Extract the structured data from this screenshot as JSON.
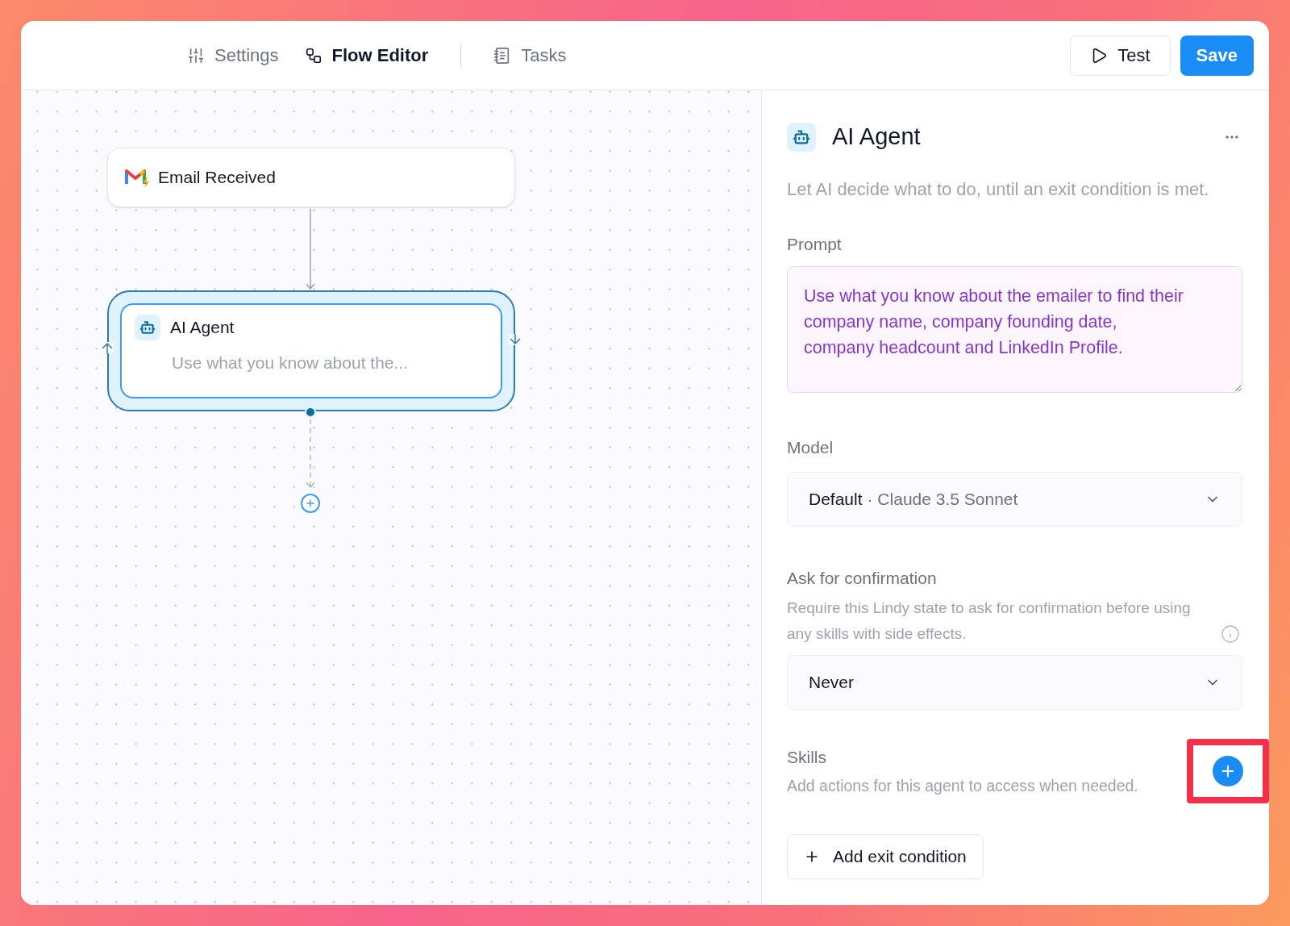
{
  "tabs": [
    {
      "label": "Settings",
      "kind": "settings",
      "selected": false
    },
    {
      "label": "Flow Editor",
      "kind": "flow",
      "selected": true
    },
    {
      "label": "Tasks",
      "kind": "tasks",
      "selected": false
    }
  ],
  "actions": {
    "test": "Test",
    "save": "Save"
  },
  "canvas": {
    "nodes": [
      {
        "kind": "trigger",
        "title": "Email Received"
      },
      {
        "kind": "agent",
        "title": "AI Agent",
        "subtitle": "Use what you know about the...",
        "selected": true
      }
    ]
  },
  "panel": {
    "title": "AI Agent",
    "description": "Let AI decide what to do, until an exit condition is met.",
    "prompt": {
      "label": "Prompt",
      "value": "Use what you know about the emailer to find their company name, company founding date, company headcount and LinkedIn Profile."
    },
    "model": {
      "label": "Model",
      "value": "Default",
      "detail": "· Claude 3.5 Sonnet"
    },
    "confirmation": {
      "label": "Ask for confirmation",
      "description": "Require this Lindy state to ask for confirmation before using any skills with side effects.",
      "value": "Never"
    },
    "skills": {
      "label": "Skills",
      "description": "Add actions for this agent to access when needed.",
      "highlighted": true
    },
    "exit_button": "Add exit condition"
  }
}
